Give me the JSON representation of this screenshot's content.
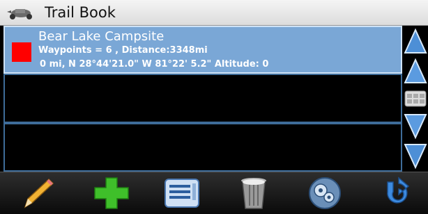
{
  "app": {
    "title": "Trail Book"
  },
  "trails": [
    {
      "name": "Bear Lake Campsite",
      "line2": "Waypoints = 6  , Distance:3348mi",
      "line3": "0 mi, N 28°44'21.0\"  W 81°22' 5.2\" Altitude: 0",
      "color": "#ff0000",
      "selected": true
    }
  ],
  "sidebar": [
    "page-up-icon",
    "scroll-up-icon",
    "keyboard-icon",
    "scroll-down-icon",
    "page-down-icon"
  ],
  "toolbar": [
    "pencil-icon",
    "add-icon",
    "list-icon",
    "trash-icon",
    "gears-icon",
    "back-icon"
  ]
}
